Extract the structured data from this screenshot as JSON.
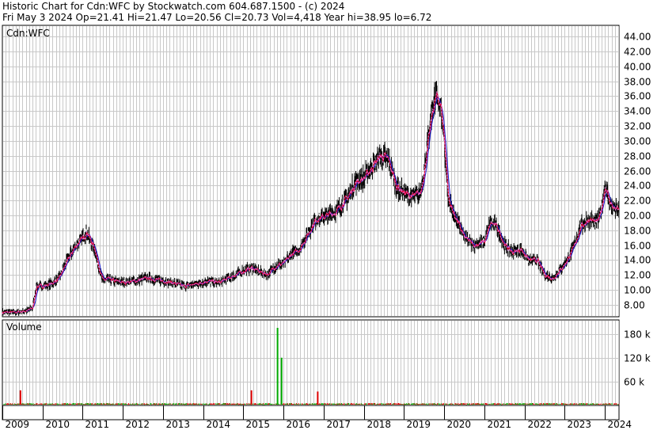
{
  "header": {
    "line1": "Historic Chart for Cdn:WFC by Stockwatch.com 604.687.1500 - (c) 2024",
    "line2": "Fri May  3 2024   Op=21.41  Hi=21.47  Lo=20.56  Cl=20.73  Vol=4,418  Year hi=38.95  lo=6.72"
  },
  "chart_data": {
    "type": "line",
    "symbol_label": "Cdn:WFC",
    "volume_label": "Volume",
    "x_range": [
      2009.0,
      2024.35
    ],
    "price_ylim": [
      6.4,
      45.5
    ],
    "price_ticks": [
      8,
      10,
      12,
      14,
      16,
      18,
      20,
      22,
      24,
      26,
      28,
      30,
      32,
      34,
      36,
      38,
      40,
      42,
      44
    ],
    "price_tick_labels": [
      "8.00",
      "10.00",
      "12.00",
      "14.00",
      "16.00",
      "18.00",
      "20.00",
      "22.00",
      "24.00",
      "26.00",
      "28.00",
      "30.00",
      "32.00",
      "34.00",
      "36.00",
      "38.00",
      "40.00",
      "42.00",
      "44.00"
    ],
    "volume_ylim": [
      0,
      215000
    ],
    "volume_ticks": [
      60000,
      120000,
      180000
    ],
    "volume_tick_labels": [
      "60 k",
      "120 k",
      "180 k"
    ],
    "year_labels": [
      "2009",
      "2010",
      "2011",
      "2012",
      "2013",
      "2014",
      "2015",
      "2016",
      "2017",
      "2018",
      "2019",
      "2020",
      "2021",
      "2022",
      "2023",
      "2024"
    ],
    "grid": true,
    "colors": {
      "price": "#000000",
      "ma_short": "#e8002a",
      "ma_mid": "#e070e0",
      "ma_long": "#1a1ad0",
      "vol_up": "#00aa00",
      "vol_down": "#dd0000",
      "grid": "#c8c8c8"
    },
    "price": {
      "x": [
        2009.0,
        2009.3,
        2009.6,
        2009.75,
        2009.85,
        2010.0,
        2010.2,
        2010.4,
        2010.6,
        2010.8,
        2011.0,
        2011.1,
        2011.2,
        2011.3,
        2011.4,
        2011.5,
        2011.6,
        2011.8,
        2012.0,
        2012.3,
        2012.6,
        2012.9,
        2013.2,
        2013.5,
        2013.8,
        2014.1,
        2014.4,
        2014.7,
        2015.0,
        2015.2,
        2015.4,
        2015.6,
        2015.8,
        2016.0,
        2016.2,
        2016.4,
        2016.6,
        2016.8,
        2017.0,
        2017.3,
        2017.6,
        2017.8,
        2018.0,
        2018.2,
        2018.4,
        2018.6,
        2018.8,
        2019.0,
        2019.2,
        2019.4,
        2019.5,
        2019.6,
        2019.7,
        2019.8,
        2019.9,
        2020.0,
        2020.1,
        2020.25,
        2020.5,
        2020.75,
        2021.0,
        2021.15,
        2021.3,
        2021.5,
        2021.7,
        2021.9,
        2022.1,
        2022.3,
        2022.5,
        2022.7,
        2022.85,
        2023.0,
        2023.2,
        2023.4,
        2023.6,
        2023.8,
        2023.9,
        2024.0,
        2024.1,
        2024.2,
        2024.34
      ],
      "y": [
        7.0,
        7.0,
        7.2,
        7.6,
        10.5,
        10.5,
        10.8,
        11.5,
        13.8,
        15.8,
        17.0,
        17.8,
        16.5,
        15.5,
        13.0,
        11.2,
        11.5,
        11.2,
        11.0,
        11.2,
        11.6,
        11.3,
        11.0,
        10.5,
        10.8,
        11.2,
        11.0,
        11.8,
        12.5,
        13.0,
        12.4,
        12.1,
        13.2,
        13.6,
        14.8,
        15.5,
        17.5,
        19.5,
        19.8,
        20.5,
        22.5,
        24.5,
        25.0,
        26.5,
        28.0,
        27.5,
        24.0,
        23.0,
        22.5,
        23.0,
        26.0,
        30.0,
        34.0,
        36.0,
        35.0,
        30.0,
        22.0,
        20.0,
        17.0,
        16.0,
        16.5,
        19.0,
        18.5,
        16.0,
        15.0,
        15.5,
        14.0,
        14.0,
        12.0,
        11.5,
        12.5,
        13.5,
        15.5,
        18.5,
        19.5,
        19.0,
        20.5,
        24.0,
        22.0,
        21.0,
        20.7
      ]
    },
    "volume": {
      "spikes_x": [
        2009.45,
        2015.2,
        2015.85,
        2015.95,
        2016.85
      ],
      "spikes_v": [
        38000,
        38000,
        195000,
        120000,
        35000
      ],
      "spikes_dir": [
        "down",
        "down",
        "up",
        "up",
        "down"
      ]
    }
  }
}
